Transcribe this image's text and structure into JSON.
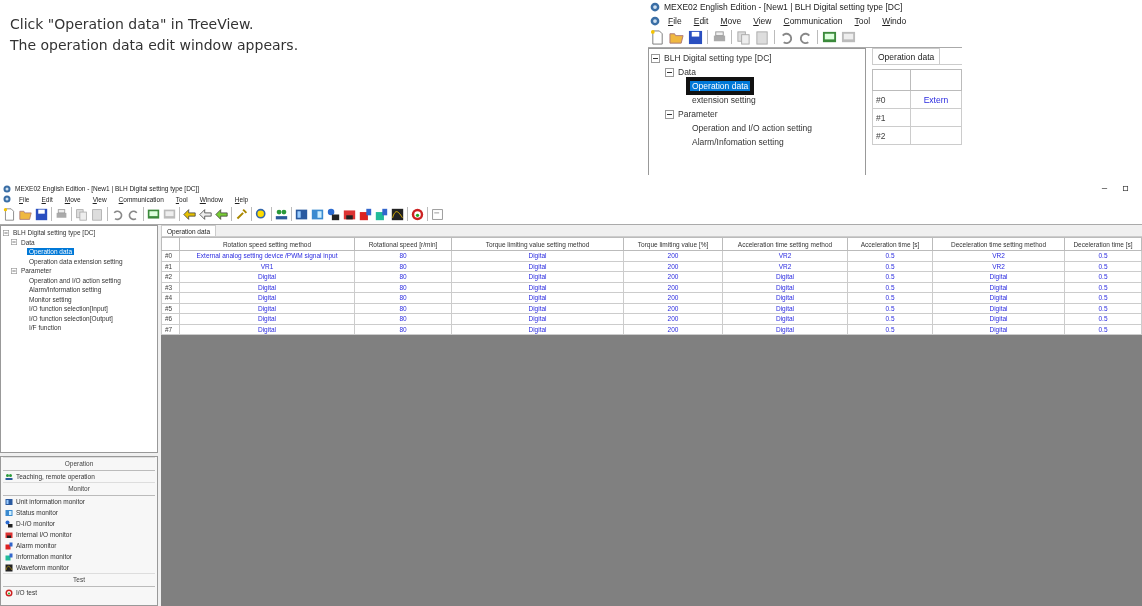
{
  "instructions": [
    "Click \"Operation data\" in TreeView.",
    "The operation data edit window appears."
  ],
  "inset": {
    "title": "MEXE02 English Edition - [New1 | BLH Digital setting type [DC]",
    "menu": [
      "File",
      "Edit",
      "Move",
      "View",
      "Communication",
      "Tool",
      "Windo"
    ],
    "tree": [
      {
        "label": "BLH Digital setting type [DC]",
        "expanded": true,
        "selected": false,
        "children": [
          {
            "label": "Data",
            "expanded": true,
            "selected": false,
            "children": [
              {
                "label": "Operation data",
                "selected": true,
                "highlighted": true
              },
              {
                "label": "extension setting",
                "selected": false,
                "highlighted": false
              }
            ]
          },
          {
            "label": "Parameter",
            "expanded": true,
            "selected": false,
            "children": [
              {
                "label": "Operation and I/O action setting",
                "selected": false,
                "highlighted": false
              },
              {
                "label": "Alarm/Infomation setting",
                "selected": false,
                "highlighted": false
              }
            ]
          }
        ]
      }
    ],
    "tab": "Operation data",
    "rows": [
      {
        "label": "#0",
        "cell": "Extern"
      },
      {
        "label": "#1",
        "cell": ""
      },
      {
        "label": "#2",
        "cell": ""
      }
    ]
  },
  "window": {
    "title": "MEXE02 English Edition - [New1 | BLH Digital setting type [DC]]",
    "menu": [
      "File",
      "Edit",
      "Move",
      "View",
      "Communication",
      "Tool",
      "Window",
      "Help"
    ],
    "tree": [
      {
        "label": "BLH Digital setting type [DC]",
        "expanded": true,
        "selected": false,
        "children": [
          {
            "label": "Data",
            "expanded": true,
            "selected": false,
            "children": [
              {
                "label": "Operation data",
                "selected": true
              },
              {
                "label": "Operation data extension setting",
                "selected": false
              }
            ]
          },
          {
            "label": "Parameter",
            "expanded": true,
            "selected": false,
            "children": [
              {
                "label": "Operation and I/O action setting",
                "selected": false
              },
              {
                "label": "Alarm/Information setting",
                "selected": false
              },
              {
                "label": "Monitor setting",
                "selected": false
              },
              {
                "label": "I/O function selection[Input]",
                "selected": false
              },
              {
                "label": "I/O function selection[Output]",
                "selected": false
              },
              {
                "label": "I/F function",
                "selected": false
              }
            ]
          }
        ]
      }
    ],
    "nav": [
      {
        "heading": "Operation",
        "items": [
          "Teaching, remote operation"
        ]
      },
      {
        "heading": "Monitor",
        "items": [
          "Unit information monitor",
          "Status monitor",
          "D-I/O monitor",
          "Internal I/O monitor",
          "Alarm monitor",
          "Information monitor",
          "Waveform monitor"
        ]
      },
      {
        "heading": "Test",
        "items": [
          "I/O test"
        ]
      }
    ],
    "tab": "Operation data",
    "table": {
      "columns": [
        "",
        "Rotation speed setting method",
        "Rotational speed [r/min]",
        "Torque limiting value setting method",
        "Torque limiting value [%]",
        "Acceleration time setting method",
        "Acceleration time [s]",
        "Deceleration time setting method",
        "Deceleration time [s]"
      ],
      "rows": [
        {
          "cells": [
            "#0",
            "External analog setting device /PWM signal input",
            "80",
            "Digital",
            "200",
            "VR2",
            "0.5",
            "VR2",
            "0.5"
          ]
        },
        {
          "cells": [
            "#1",
            "VR1",
            "80",
            "Digital",
            "200",
            "VR2",
            "0.5",
            "VR2",
            "0.5"
          ]
        },
        {
          "cells": [
            "#2",
            "Digital",
            "80",
            "Digital",
            "200",
            "Digital",
            "0.5",
            "Digital",
            "0.5"
          ]
        },
        {
          "cells": [
            "#3",
            "Digital",
            "80",
            "Digital",
            "200",
            "Digital",
            "0.5",
            "Digital",
            "0.5"
          ]
        },
        {
          "cells": [
            "#4",
            "Digital",
            "80",
            "Digital",
            "200",
            "Digital",
            "0.5",
            "Digital",
            "0.5"
          ]
        },
        {
          "cells": [
            "#5",
            "Digital",
            "80",
            "Digital",
            "200",
            "Digital",
            "0.5",
            "Digital",
            "0.5"
          ]
        },
        {
          "cells": [
            "#6",
            "Digital",
            "80",
            "Digital",
            "200",
            "Digital",
            "0.5",
            "Digital",
            "0.5"
          ]
        },
        {
          "cells": [
            "#7",
            "Digital",
            "80",
            "Digital",
            "200",
            "Digital",
            "0.5",
            "Digital",
            "0.5"
          ]
        }
      ]
    }
  }
}
